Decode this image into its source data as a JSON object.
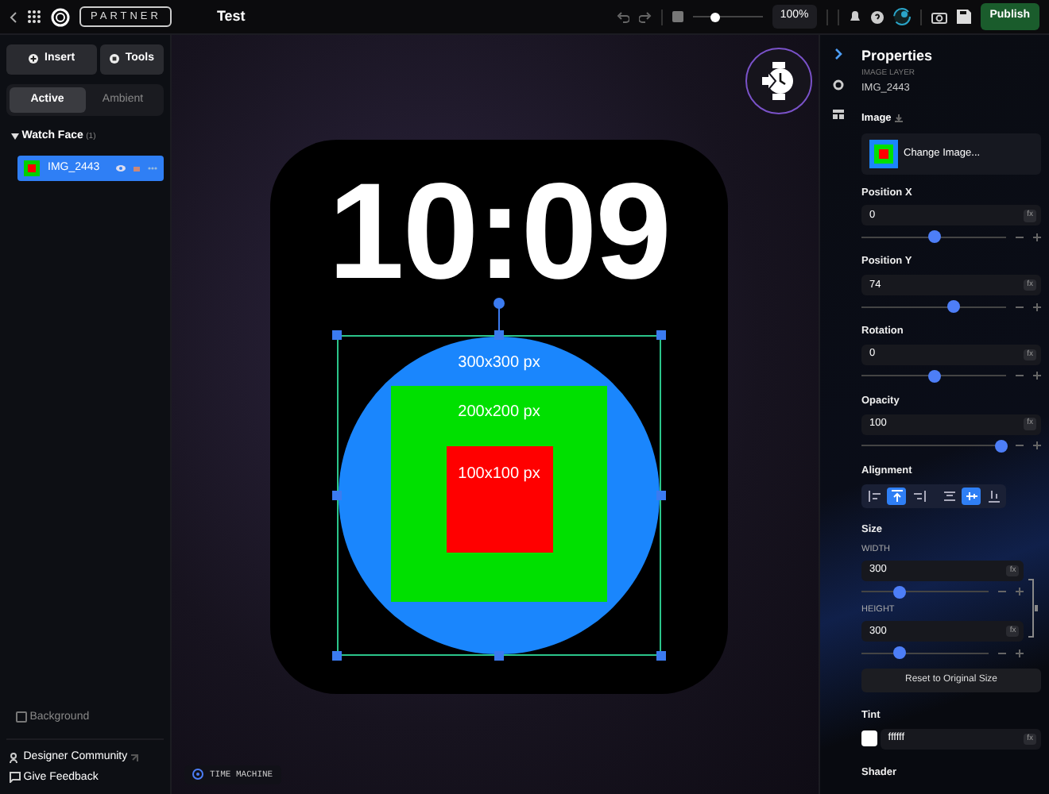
{
  "topbar": {
    "badge": "PARTNER",
    "title": "Test",
    "zoom": {
      "level": 0.35,
      "value": "100%"
    },
    "publish": "Publish"
  },
  "left_panel": {
    "insert": "Insert",
    "tools": "Tools",
    "tabs": [
      {
        "label": "Active",
        "selected": true
      },
      {
        "label": "Ambient",
        "selected": false
      }
    ],
    "layers": [
      {
        "name": "Watch Face",
        "count": "(1)",
        "expanded": true,
        "children": [
          {
            "name": "IMG_2443",
            "selected": true
          }
        ]
      }
    ],
    "background": {
      "label": "Background",
      "checked": false
    },
    "links": [
      {
        "label": "Designer Community",
        "kind": "external"
      },
      {
        "label": "Give Feedback",
        "kind": "feedback"
      }
    ]
  },
  "canvas": {
    "time": "10:09",
    "labels": [
      "300x300 px",
      "200x200 px",
      "100x100 px"
    ],
    "time_machine": "TIME MACHINE"
  },
  "properties": {
    "title": "Properties",
    "subtitle": "IMAGE LAYER",
    "layer_name": "IMG_2443",
    "image_label": "Image",
    "change_image": "Change Image...",
    "fields": [
      {
        "label": "Position X",
        "value": "0",
        "suffix": "fx",
        "level": 0.5
      },
      {
        "label": "Position Y",
        "value": "74",
        "suffix": "fx",
        "level": 0.64
      },
      {
        "label": "Rotation",
        "value": "0",
        "suffix": "fx",
        "level": 0.5
      },
      {
        "label": "Opacity",
        "value": "100",
        "suffix": "fx",
        "level": 0.97
      }
    ],
    "alignment": {
      "label": "Alignment",
      "buttons": [
        {
          "kind": "left",
          "selected": false
        },
        {
          "kind": "top",
          "selected": true
        },
        {
          "kind": "right",
          "selected": false
        },
        {
          "kind": "hcenter",
          "selected": false
        },
        {
          "kind": "vcenter",
          "selected": true
        },
        {
          "kind": "bottom",
          "selected": false
        }
      ]
    },
    "size": {
      "label": "Size",
      "fields": [
        {
          "label": "WIDTH",
          "value": "300",
          "suffix": "fx",
          "level": 0.3
        },
        {
          "label": "HEIGHT",
          "value": "300",
          "suffix": "fx",
          "level": 0.3
        }
      ],
      "reset": "Reset to Original Size"
    },
    "tint": {
      "label": "Tint",
      "color": "#ffffff",
      "value": "ffffff",
      "suffix": "fx"
    },
    "shader": {
      "label": "Shader"
    }
  }
}
